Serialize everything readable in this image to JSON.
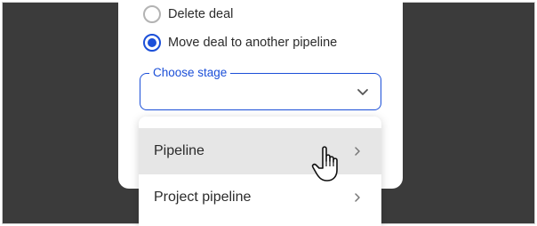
{
  "dialog": {
    "options": [
      {
        "label": "Delete deal",
        "selected": false
      },
      {
        "label": "Move deal to another pipeline",
        "selected": true
      }
    ],
    "stage_field": {
      "legend": "Choose stage",
      "value": ""
    }
  },
  "menu": {
    "items": [
      {
        "label": "Pipeline",
        "hovered": true
      },
      {
        "label": "Project pipeline",
        "hovered": false
      }
    ]
  },
  "colors": {
    "accent": "#1b4fd8",
    "backdrop": "#3b3b3b",
    "hover": "#e6e6e6"
  },
  "icons": [
    "chevron-down-icon",
    "chevron-right-icon",
    "hand-pointer-cursor-icon"
  ]
}
